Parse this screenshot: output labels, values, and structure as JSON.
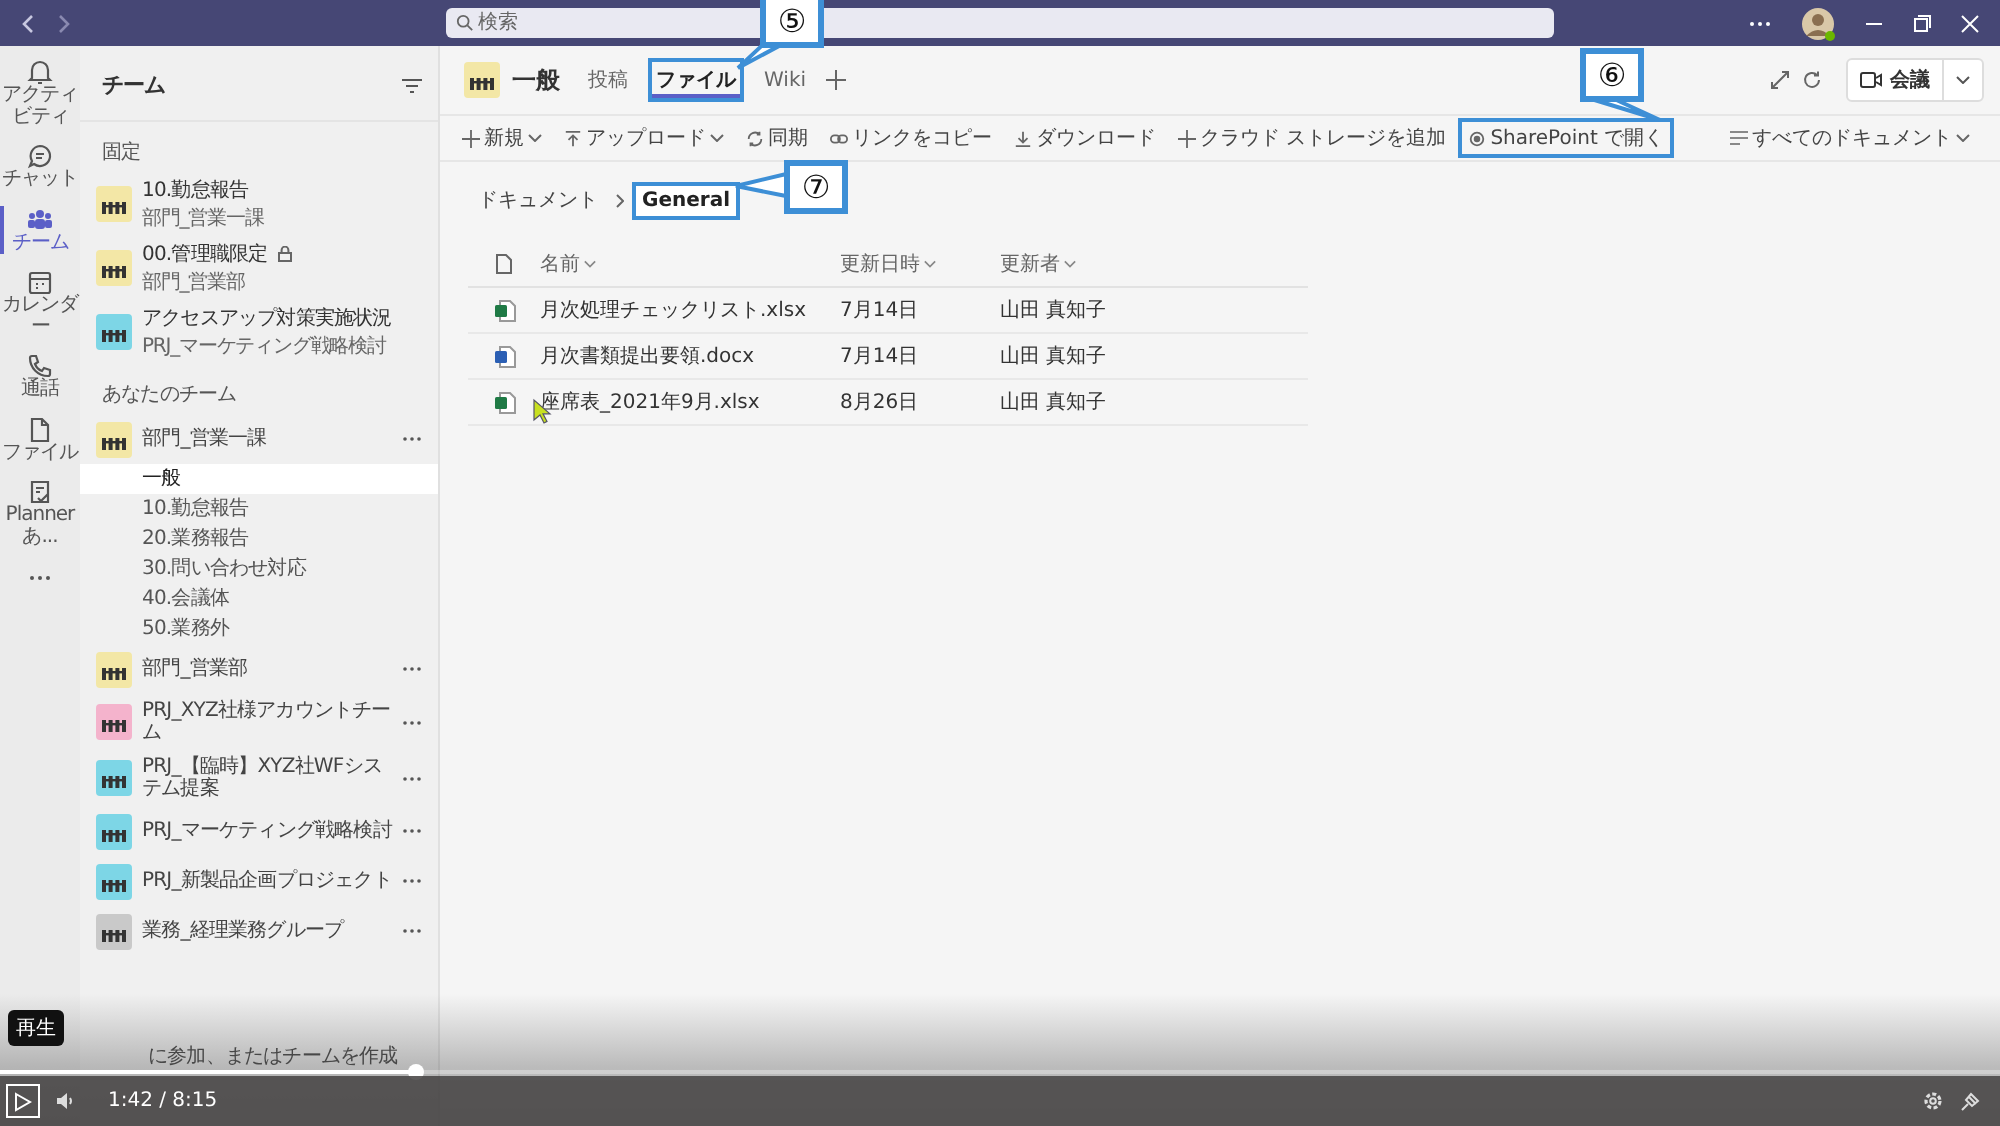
{
  "top_bar": {
    "search": {
      "placeholder": "検索"
    }
  },
  "app_rail": [
    {
      "kind": "bell",
      "label": "アクティビティ",
      "selected": false
    },
    {
      "kind": "chat",
      "label": "チャット",
      "selected": false
    },
    {
      "kind": "team",
      "label": "チーム",
      "selected": true
    },
    {
      "kind": "calendar",
      "label": "カレンダー",
      "selected": false
    },
    {
      "kind": "phone",
      "label": "通話",
      "selected": false
    },
    {
      "kind": "file",
      "label": "ファイル",
      "selected": false
    },
    {
      "kind": "planner",
      "label": "Planner あ...",
      "selected": false
    }
  ],
  "sidebar": {
    "title": "チーム",
    "pinned": {
      "heading": "固定",
      "items": [
        {
          "title": "10.勤怠報告",
          "subtitle": "部門_営業一課",
          "color": "#f3e7a6",
          "locked": false
        },
        {
          "title": "00.管理職限定",
          "subtitle": "部門_営業部",
          "color": "#f3e7a6",
          "locked": true
        },
        {
          "title": "アクセスアップ対策実施状況",
          "subtitle": "PRJ_マーケティング戦略検討",
          "color": "#7dd6e6",
          "locked": false
        }
      ]
    },
    "teams_heading": "あなたのチーム",
    "teams": [
      {
        "name": "部門_営業一課",
        "color": "#f3e7a6",
        "channels": [
          {
            "name": "一般",
            "selected": true
          },
          {
            "name": "10.勤怠報告",
            "selected": false
          },
          {
            "name": "20.業務報告",
            "selected": false
          },
          {
            "name": "30.問い合わせ対応",
            "selected": false
          },
          {
            "name": "40.会議体",
            "selected": false
          },
          {
            "name": "50.業務外",
            "selected": false
          }
        ]
      },
      {
        "name": "部門_営業部",
        "color": "#f3e7a6"
      },
      {
        "name": "PRJ_XYZ社様アカウントチーム",
        "color": "#f4b3cc"
      },
      {
        "name": "PRJ_【臨時】XYZ社WFシステム提案",
        "color": "#7dd6e6"
      },
      {
        "name": "PRJ_マーケティング戦略検討",
        "color": "#7dd6e6"
      },
      {
        "name": "PRJ_新製品企画プロジェクト",
        "color": "#7dd6e6"
      },
      {
        "name": "業務_経理業務グループ",
        "color": "#c9c9c9"
      }
    ],
    "footer": "に参加、またはチームを作成"
  },
  "channel_header": {
    "color": "#f3e7a6",
    "title": "一般",
    "tabs": [
      {
        "label": "投稿",
        "selected": false,
        "highlighted": false
      },
      {
        "label": "ファイル",
        "selected": true,
        "highlighted": true
      },
      {
        "label": "Wiki",
        "selected": false,
        "highlighted": false
      }
    ],
    "meeting_button": "会議"
  },
  "toolbar": {
    "items": [
      {
        "kind": "plus",
        "label": "新規",
        "caret": true,
        "highlighted": false
      },
      {
        "kind": "upload",
        "label": "アップロード",
        "caret": true,
        "highlighted": false
      },
      {
        "kind": "sync",
        "label": "同期",
        "caret": false,
        "highlighted": false
      },
      {
        "kind": "link",
        "label": "リンクをコピー",
        "caret": false,
        "highlighted": false
      },
      {
        "kind": "download",
        "label": "ダウンロード",
        "caret": false,
        "highlighted": false
      },
      {
        "kind": "plus",
        "label": "クラウド ストレージを追加",
        "caret": false,
        "highlighted": false
      },
      {
        "kind": "sharepoint",
        "label": "SharePoint で開く",
        "caret": false,
        "highlighted": true
      }
    ],
    "view": "すべてのドキュメント"
  },
  "breadcrumb": [
    {
      "label": "ドキュメント",
      "highlighted": false
    },
    {
      "label": "General",
      "highlighted": true
    }
  ],
  "table": {
    "columns": [
      "名前",
      "更新日時",
      "更新者"
    ],
    "rows": [
      {
        "kind": "excel",
        "name": "月次処理チェックリスト.xlsx",
        "modified": "7月14日",
        "modified_by": "山田 真知子"
      },
      {
        "kind": "word",
        "name": "月次書類提出要領.docx",
        "modified": "7月14日",
        "modified_by": "山田 真知子"
      },
      {
        "kind": "excel",
        "name": "座席表_2021年9月.xlsx",
        "modified": "8月26日",
        "modified_by": "山田 真知子"
      }
    ]
  },
  "callouts": [
    {
      "number": "⑤"
    },
    {
      "number": "⑥"
    },
    {
      "number": "⑦"
    }
  ],
  "player": {
    "tooltip": "再生",
    "time": "1:42 / 8:15",
    "level": 0.208
  }
}
